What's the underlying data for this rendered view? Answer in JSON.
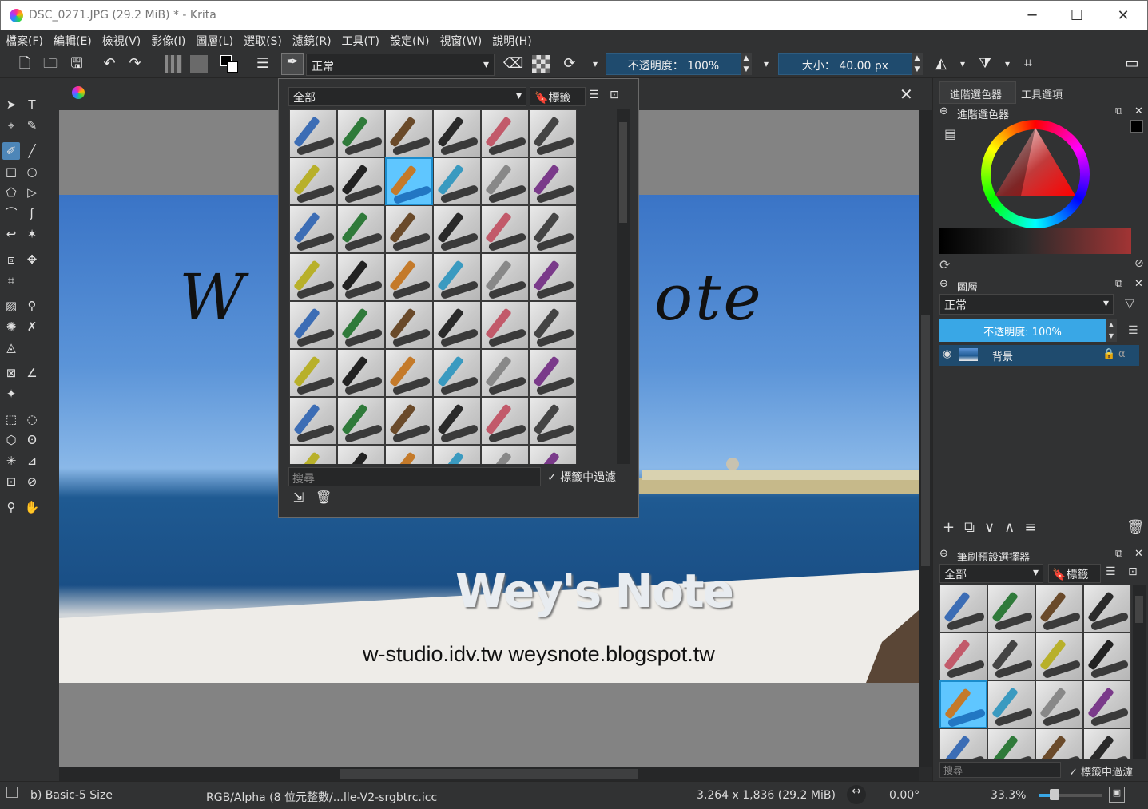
{
  "window": {
    "title": "DSC_0271.JPG (29.2 MiB)  * - Krita",
    "minimize": "─",
    "maximize": "☐",
    "close": "✕"
  },
  "menu": [
    "檔案(F)",
    "編輯(E)",
    "檢視(V)",
    "影像(I)",
    "圖層(L)",
    "選取(S)",
    "濾鏡(R)",
    "工具(T)",
    "設定(N)",
    "視窗(W)",
    "說明(H)"
  ],
  "toolbar": {
    "blend_mode": "正常",
    "opacity": "不透明度：  100%",
    "size": "大小：  40.00 px"
  },
  "popup": {
    "tag_filter": "全部",
    "tag_button": "標籤",
    "search_placeholder": "搜尋",
    "filter_in_tag": "標籤中過濾",
    "close": "✕"
  },
  "canvas": {
    "watermark_title": "Wey's Note",
    "watermark_urls": "w-studio.idv.tw  weysnote.blogspot.tw",
    "signature_left": "W",
    "signature_right": "ote"
  },
  "docker": {
    "tab_advanced_color": "進階選色器",
    "tab_tool_options": "工具選項",
    "advanced_color_title": "進階選色器",
    "layers_title": "圖層",
    "layer_blend": "正常",
    "layer_opacity": "不透明度:  100%",
    "layer_name": "背景",
    "brush_presets_title": "筆刷預設選擇器",
    "brush_tag_filter": "全部",
    "brush_tag_button": "標籤",
    "brush_search": "搜尋",
    "brush_filter_in_tag": "標籤中過濾"
  },
  "status": {
    "preset": "b) Basic-5 Size",
    "colorspace": "RGB/Alpha (8 位元整數/...lle-V2-srgbtrc.icc",
    "dimensions": "3,264 x 1,836 (29.2 MiB)",
    "rotation": "0.00°",
    "zoom": "33.3%"
  },
  "colors": {
    "accent": "#4d86b8",
    "selected_brush": "#5fc6ff",
    "opacity_slider": "#39a7e6"
  }
}
